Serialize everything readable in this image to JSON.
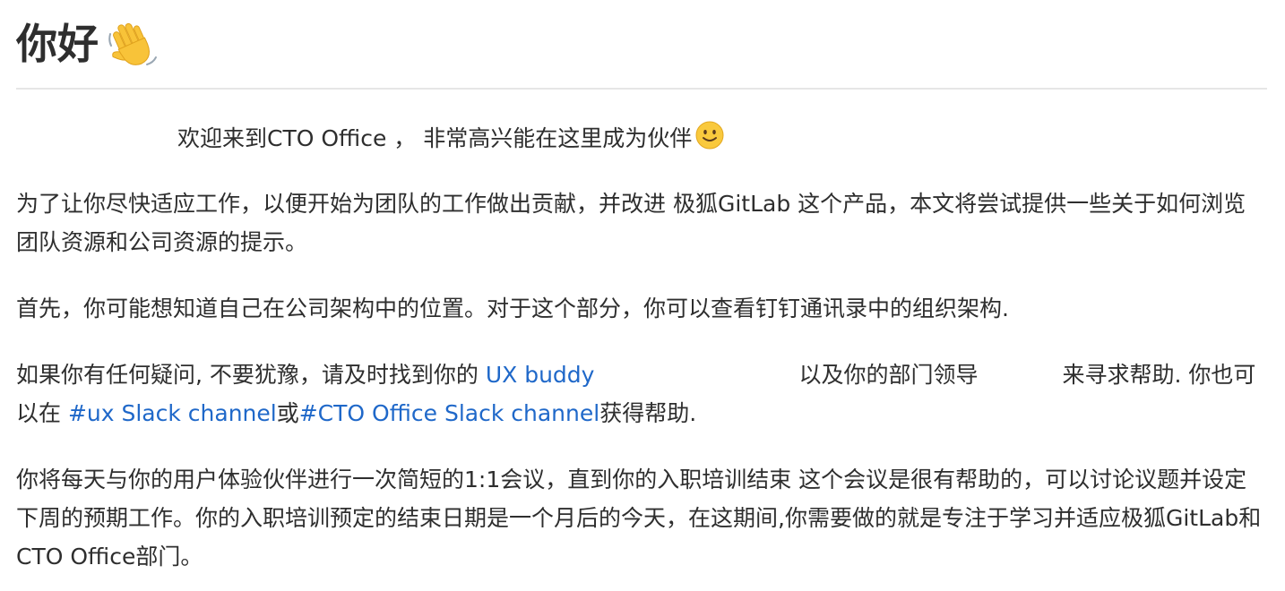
{
  "heading": {
    "title": "你好"
  },
  "icons": {
    "wave": "waving-hand-icon",
    "smile": "smiling-face-icon"
  },
  "colors": {
    "text": "#2e2e2e",
    "link": "#1f68c9",
    "divider": "#e6e6e6"
  },
  "p1": {
    "text": "欢迎来到CTO Office ， 非常高兴能在这里成为伙伴"
  },
  "p2": {
    "text": "为了让你尽快适应工作，以便开始为团队的工作做出贡献，并改进 极狐GitLab 这个产品，本文将尝试提供一些关于如何浏览团队资源和公司资源的提示。"
  },
  "p3": {
    "text": "首先，你可能想知道自己在公司架构中的位置。对于这个部分，你可以查看钉钉通讯录中的组织架构."
  },
  "p4": {
    "t1": "如果你有任何疑问, 不要犹豫，请及时找到你的 ",
    "link1": "UX buddy",
    "t2": "以及你的部门领导",
    "t3": "来寻求帮助. 你也可以在 ",
    "link2": "#ux Slack channel",
    "t4": "或",
    "link3": "#CTO Office Slack channel",
    "t5": "获得帮助."
  },
  "p5": {
    "text": "你将每天与你的用户体验伙伴进行一次简短的1:1会议，直到你的入职培训结束 这个会议是很有帮助的，可以讨论议题并设定下周的预期工作。你的入职培训预定的结束日期是一个月后的今天，在这期间,你需要做的就是专注于学习并适应极狐GitLab和CTO Office部门。"
  }
}
